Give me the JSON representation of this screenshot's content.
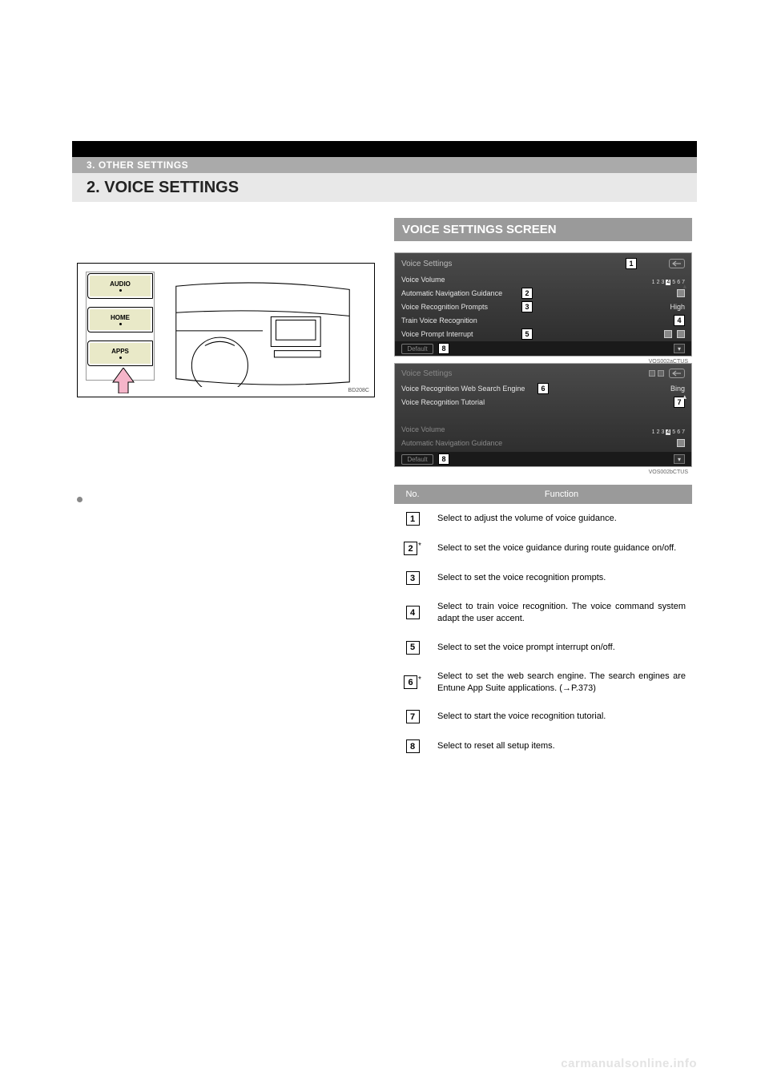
{
  "header": {
    "section_label": "3. OTHER SETTINGS",
    "title": "2. VOICE SETTINGS"
  },
  "left": {
    "buttons": [
      "AUDIO",
      "HOME",
      "APPS"
    ],
    "fig_code": "BD208C"
  },
  "right": {
    "subheading": "VOICE SETTINGS SCREEN",
    "screenshot1": {
      "title": "Voice Settings",
      "rows": [
        {
          "label": "Voice Volume",
          "callout": "1",
          "scale": [
            "1",
            "2",
            "3",
            "4",
            "5",
            "6",
            "7"
          ]
        },
        {
          "label": "Automatic Navigation Guidance",
          "callout": "2"
        },
        {
          "label": "Voice Recognition Prompts",
          "callout": "3",
          "right": "High"
        },
        {
          "label": "Train Voice Recognition",
          "callout": "4"
        },
        {
          "label": "Voice Prompt Interrupt",
          "callout": "5"
        }
      ],
      "default_label": "Default",
      "default_callout": "8",
      "code": "VOS002aCTUS"
    },
    "screenshot2": {
      "title": "Voice Settings",
      "rows": [
        {
          "label": "Voice Recognition Web Search Engine",
          "callout": "6",
          "right": "Bing"
        },
        {
          "label": "Voice Recognition Tutorial",
          "callout": "7"
        },
        {
          "label": "",
          "callout": ""
        },
        {
          "label": "Voice Volume",
          "scale": [
            "1",
            "2",
            "3",
            "4",
            "5",
            "6",
            "7"
          ]
        },
        {
          "label": "Automatic Navigation Guidance"
        }
      ],
      "default_label": "Default",
      "default_callout": "8",
      "code": "VOS002bCTUS"
    },
    "table": {
      "headers": [
        "No.",
        "Function"
      ],
      "rows": [
        {
          "num": "1",
          "ast": false,
          "desc": "Select to adjust the volume of voice guidance."
        },
        {
          "num": "2",
          "ast": true,
          "desc": "Select to set the voice guidance during route guidance on/off."
        },
        {
          "num": "3",
          "ast": false,
          "desc": "Select to set the voice recognition prompts."
        },
        {
          "num": "4",
          "ast": false,
          "desc": "Select to train voice recognition. The voice command system adapt the user accent."
        },
        {
          "num": "5",
          "ast": false,
          "desc": "Select to set the voice prompt interrupt on/off."
        },
        {
          "num": "6",
          "ast": true,
          "desc": "Select to set the web search engine. The search engines are Entune App Suite applications. (→P.373)"
        },
        {
          "num": "7",
          "ast": false,
          "desc": "Select to start the voice recognition tutorial."
        },
        {
          "num": "8",
          "ast": false,
          "desc": "Select to reset all setup items."
        }
      ]
    }
  },
  "watermark": "carmanualsonline.info"
}
